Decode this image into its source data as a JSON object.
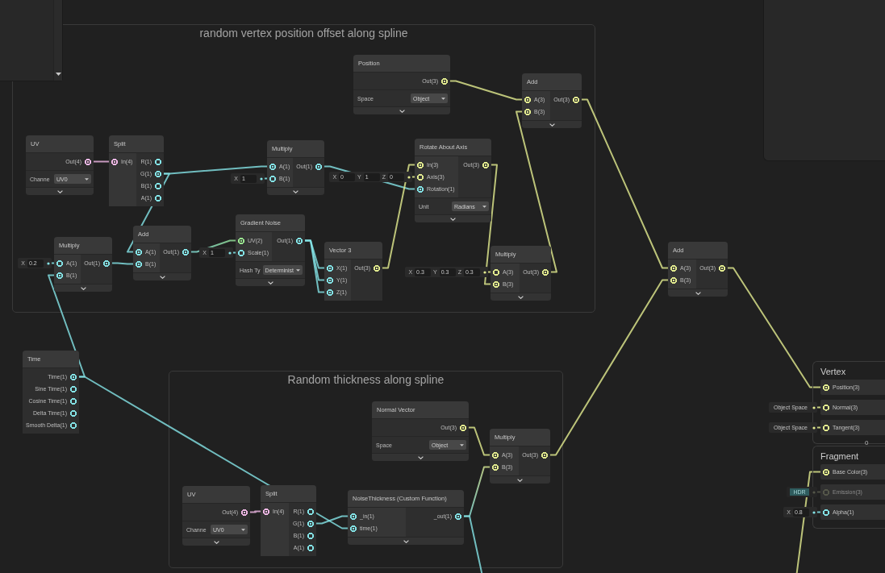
{
  "groups": [
    {
      "title": "random vertex position offset along spline",
      "nodes": [
        {
          "title": "Position",
          "outputs": [
            {
              "label": "Out(3)",
              "connected": true,
              "color": "#e3ec8f"
            }
          ],
          "controls": [
            {
              "label": "Space",
              "value": "Object"
            }
          ],
          "collapse_toggle": true
        },
        {
          "title": "Add",
          "inputs": [
            {
              "label": "A(3)",
              "connected": true,
              "color": "#e3ec8f"
            },
            {
              "label": "B(3)",
              "connected": true,
              "color": "#e3ec8f"
            }
          ],
          "outputs": [
            {
              "label": "Out(3)",
              "connected": true,
              "color": "#e3ec8f"
            }
          ],
          "collapse_toggle": true
        },
        {
          "title": "UV",
          "outputs": [
            {
              "label": "Out(4)",
              "connected": true,
              "color": "#f0b8e6"
            }
          ],
          "controls": [
            {
              "label": "Channe",
              "value": "UV0"
            }
          ],
          "collapse_toggle": true
        },
        {
          "title": "Split",
          "inputs": [
            {
              "label": "In(4)",
              "connected": true,
              "color": "#f0b8e6"
            }
          ],
          "outputs": [
            {
              "label": "R(1)",
              "connected": false,
              "color": "#84e4e7"
            },
            {
              "label": "G(1)",
              "connected": true,
              "color": "#84e4e7"
            },
            {
              "label": "B(1)",
              "connected": false,
              "color": "#84e4e7"
            },
            {
              "label": "A(1)",
              "connected": false,
              "color": "#84e4e7"
            }
          ],
          "collapse_toggle": false
        },
        {
          "title": "Multiply",
          "inputs": [
            {
              "label": "A(1)",
              "connected": true,
              "color": "#84e4e7"
            },
            {
              "label": "B(1)",
              "connected": false,
              "color": "#84e4e7",
              "inline": {
                "kind": "vector",
                "fields": [
                  {
                    "axis": "X",
                    "value": "1"
                  }
                ]
              }
            }
          ],
          "outputs": [
            {
              "label": "Out(1)",
              "connected": true,
              "color": "#84e4e7"
            }
          ],
          "collapse_toggle": true
        },
        {
          "title": "Rotate About Axis",
          "inputs": [
            {
              "label": "In(3)",
              "connected": true,
              "color": "#e3ec8f"
            },
            {
              "label": "Axis(3)",
              "connected": false,
              "color": "#e3ec8f",
              "inline": {
                "kind": "vector",
                "fields": [
                  {
                    "axis": "X",
                    "value": "0"
                  },
                  {
                    "axis": "Y",
                    "value": "1"
                  },
                  {
                    "axis": "Z",
                    "value": "0"
                  }
                ]
              }
            },
            {
              "label": "Rotation(1)",
              "connected": true,
              "color": "#84e4e7"
            }
          ],
          "outputs": [
            {
              "label": "Out(3)",
              "connected": true,
              "color": "#e3ec8f"
            }
          ],
          "controls": [
            {
              "label": "Unit",
              "value": "Radians"
            }
          ],
          "collapse_toggle": true
        },
        {
          "title": "Multiply",
          "inputs": [
            {
              "label": "A(1)",
              "connected": false,
              "color": "#84e4e7",
              "inline": {
                "kind": "vector",
                "fields": [
                  {
                    "axis": "X",
                    "value": "0.2"
                  }
                ]
              }
            },
            {
              "label": "B(1)",
              "connected": true,
              "color": "#84e4e7"
            }
          ],
          "outputs": [
            {
              "label": "Out(1)",
              "connected": true,
              "color": "#84e4e7"
            }
          ],
          "collapse_toggle": true
        },
        {
          "title": "Add",
          "inputs": [
            {
              "label": "A(1)",
              "connected": true,
              "color": "#84e4e7"
            },
            {
              "label": "B(1)",
              "connected": true,
              "color": "#84e4e7"
            }
          ],
          "outputs": [
            {
              "label": "Out(1)",
              "connected": true,
              "color": "#84e4e7"
            }
          ],
          "collapse_toggle": true
        },
        {
          "title": "Gradient Noise",
          "inputs": [
            {
              "label": "UV(2)",
              "connected": true,
              "color": "#9ae690"
            },
            {
              "label": "Scale(1)",
              "connected": false,
              "color": "#84e4e7",
              "inline": {
                "kind": "vector",
                "fields": [
                  {
                    "axis": "X",
                    "value": "1"
                  }
                ]
              }
            }
          ],
          "outputs": [
            {
              "label": "Out(1)",
              "connected": true,
              "color": "#84e4e7"
            }
          ],
          "controls": [
            {
              "label": "Hash Ty",
              "value": "Determinist"
            }
          ],
          "collapse_toggle": true
        },
        {
          "title": "Vector 3",
          "inputs": [
            {
              "label": "X(1)",
              "connected": true,
              "color": "#84e4e7"
            },
            {
              "label": "Y(1)",
              "connected": true,
              "color": "#84e4e7"
            },
            {
              "label": "Z(1)",
              "connected": true,
              "color": "#84e4e7"
            }
          ],
          "outputs": [
            {
              "label": "Out(3)",
              "connected": true,
              "color": "#e3ec8f"
            }
          ],
          "collapse_toggle": false
        },
        {
          "title": "Multiply",
          "inputs": [
            {
              "label": "A(3)",
              "connected": false,
              "color": "#e3ec8f",
              "inline": {
                "kind": "vector",
                "fields": [
                  {
                    "axis": "X",
                    "value": "0.3"
                  },
                  {
                    "axis": "Y",
                    "value": "0.3"
                  },
                  {
                    "axis": "Z",
                    "value": "0.3"
                  }
                ]
              }
            },
            {
              "label": "B(3)",
              "connected": true,
              "color": "#e3ec8f"
            }
          ],
          "outputs": [
            {
              "label": "Out(3)",
              "connected": true,
              "color": "#e3ec8f"
            }
          ],
          "collapse_toggle": true
        }
      ]
    },
    {
      "title": "Random thickness along spline",
      "nodes": [
        {
          "title": "Normal Vector",
          "outputs": [
            {
              "label": "Out(3)",
              "connected": true,
              "color": "#e3ec8f"
            }
          ],
          "controls": [
            {
              "label": "Space",
              "value": "Object"
            }
          ],
          "collapse_toggle": true
        },
        {
          "title": "Multiply",
          "inputs": [
            {
              "label": "A(3)",
              "connected": true,
              "color": "#e3ec8f"
            },
            {
              "label": "B(3)",
              "connected": true,
              "color": "#e3ec8f"
            }
          ],
          "outputs": [
            {
              "label": "Out(3)",
              "connected": true,
              "color": "#e3ec8f"
            }
          ],
          "collapse_toggle": true
        },
        {
          "title": "UV",
          "outputs": [
            {
              "label": "Out(4)",
              "connected": true,
              "color": "#f0b8e6"
            }
          ],
          "controls": [
            {
              "label": "Channe",
              "value": "UV0"
            }
          ],
          "collapse_toggle": true
        },
        {
          "title": "Split",
          "inputs": [
            {
              "label": "In(4)",
              "connected": true,
              "color": "#f0b8e6"
            }
          ],
          "outputs": [
            {
              "label": "R(1)",
              "connected": false,
              "color": "#84e4e7"
            },
            {
              "label": "G(1)",
              "connected": true,
              "color": "#84e4e7"
            },
            {
              "label": "B(1)",
              "connected": false,
              "color": "#84e4e7"
            },
            {
              "label": "A(1)",
              "connected": false,
              "color": "#84e4e7"
            }
          ],
          "collapse_toggle": false
        },
        {
          "title": "NoiseThickness (Custom Function)",
          "inputs": [
            {
              "label": "_in(1)",
              "connected": true,
              "color": "#84e4e7"
            },
            {
              "label": "time(1)",
              "connected": true,
              "color": "#84e4e7"
            }
          ],
          "outputs": [
            {
              "label": "_out(1)",
              "connected": true,
              "color": "#84e4e7"
            }
          ],
          "collapse_toggle": true
        }
      ]
    }
  ],
  "nodes": [
    {
      "title": "Add",
      "inputs": [
        {
          "label": "A(3)",
          "connected": true,
          "color": "#e3ec8f"
        },
        {
          "label": "B(3)",
          "connected": true,
          "color": "#e3ec8f"
        }
      ],
      "outputs": [
        {
          "label": "Out(3)",
          "connected": true,
          "color": "#e3ec8f"
        }
      ],
      "collapse_toggle": true
    },
    {
      "title": "Time",
      "outputs": [
        {
          "label": "Time(1)",
          "connected": true,
          "color": "#84e4e7"
        },
        {
          "label": "Sine Time(1)",
          "connected": false,
          "color": "#84e4e7"
        },
        {
          "label": "Cosine Time(1)",
          "connected": false,
          "color": "#84e4e7"
        },
        {
          "label": "Delta Time(1)",
          "connected": false,
          "color": "#84e4e7"
        },
        {
          "label": "Smooth Delta(1)",
          "connected": false,
          "color": "#84e4e7"
        }
      ],
      "collapse_toggle": false
    }
  ],
  "master_stack": {
    "blocks": [
      {
        "title": "Vertex",
        "ports": [
          {
            "label": "Position(3)",
            "connected": true,
            "disabled": false,
            "color": "#e3ec8f"
          },
          {
            "label": "Normal(3)",
            "connected": false,
            "disabled": false,
            "color": "#e3ec8f",
            "inline": {
              "kind": "space",
              "text": "Object Space"
            }
          },
          {
            "label": "Tangent(3)",
            "connected": false,
            "disabled": false,
            "color": "#e3ec8f",
            "inline": {
              "kind": "space",
              "text": "Object Space"
            }
          }
        ]
      },
      {
        "title": "Fragment",
        "ports": [
          {
            "label": "Base Color(3)",
            "connected": true,
            "disabled": false,
            "color": "#e3ec8f"
          },
          {
            "label": "Emission(3)",
            "connected": false,
            "disabled": true,
            "color": "#55574a",
            "inline": {
              "kind": "color",
              "text": "HDR",
              "color": "#2f5c5e"
            }
          },
          {
            "label": "Alpha(1)",
            "connected": false,
            "disabled": false,
            "color": "#84e4e7",
            "inline": {
              "kind": "vector",
              "fields": [
                {
                  "axis": "X",
                  "value": "0.8"
                }
              ]
            }
          }
        ]
      }
    ],
    "gap_label": "0"
  }
}
